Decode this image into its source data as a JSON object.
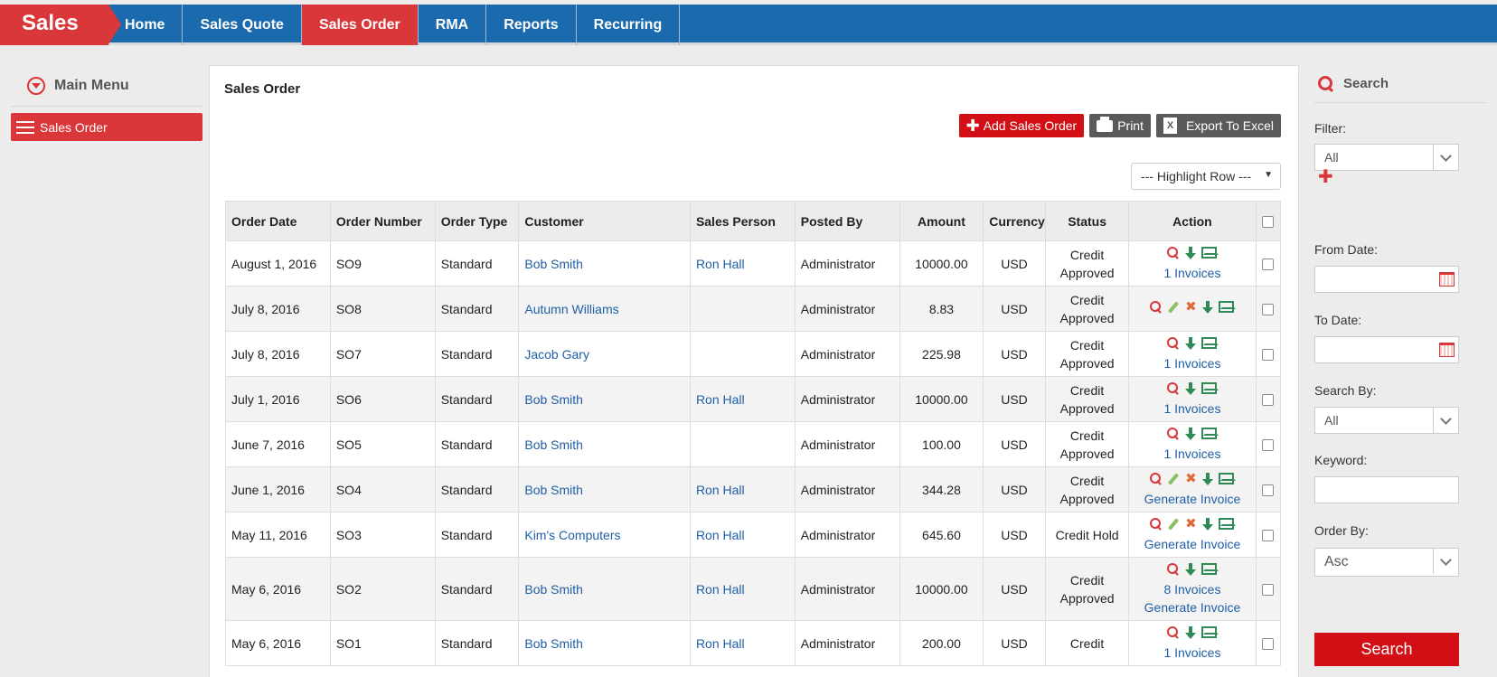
{
  "app": {
    "brand": "Sales"
  },
  "nav": {
    "home": "Home",
    "sales_quote": "Sales Quote",
    "sales_order": "Sales Order",
    "rma": "RMA",
    "reports": "Reports",
    "recurring": "Recurring"
  },
  "left_menu": {
    "title": "Main Menu",
    "item": "Sales Order"
  },
  "main": {
    "title": "Sales Order",
    "add_button": "Add Sales Order",
    "print_button": "Print",
    "export_button": "Export To Excel",
    "highlight_row": "--- Highlight Row ---"
  },
  "table": {
    "headers": {
      "order_date": "Order Date",
      "order_number": "Order Number",
      "order_type": "Order Type",
      "customer": "Customer",
      "sales_person": "Sales Person",
      "posted_by": "Posted By",
      "amount": "Amount",
      "currency": "Currency",
      "status": "Status",
      "action": "Action"
    },
    "rows": [
      {
        "date": "August 1, 2016",
        "number": "SO9",
        "type": "Standard",
        "customer": "Bob Smith",
        "sales_person": "Ron Hall",
        "posted_by": "Administrator",
        "amount": "10000.00",
        "currency": "USD",
        "status1": "Credit",
        "status2": "Approved",
        "link1": "1 Invoices",
        "link2": ""
      },
      {
        "date": "July 8, 2016",
        "number": "SO8",
        "type": "Standard",
        "customer": "Autumn Williams",
        "sales_person": "",
        "posted_by": "Administrator",
        "amount": "8.83",
        "currency": "USD",
        "status1": "Credit",
        "status2": "Approved",
        "link1": "",
        "link2": ""
      },
      {
        "date": "July 8, 2016",
        "number": "SO7",
        "type": "Standard",
        "customer": "Jacob Gary",
        "sales_person": "",
        "posted_by": "Administrator",
        "amount": "225.98",
        "currency": "USD",
        "status1": "Credit",
        "status2": "Approved",
        "link1": "1 Invoices",
        "link2": ""
      },
      {
        "date": "July 1, 2016",
        "number": "SO6",
        "type": "Standard",
        "customer": "Bob Smith",
        "sales_person": "Ron Hall",
        "posted_by": "Administrator",
        "amount": "10000.00",
        "currency": "USD",
        "status1": "Credit",
        "status2": "Approved",
        "link1": "1 Invoices",
        "link2": ""
      },
      {
        "date": "June 7, 2016",
        "number": "SO5",
        "type": "Standard",
        "customer": "Bob Smith",
        "sales_person": "",
        "posted_by": "Administrator",
        "amount": "100.00",
        "currency": "USD",
        "status1": "Credit",
        "status2": "Approved",
        "link1": "1 Invoices",
        "link2": ""
      },
      {
        "date": "June 1, 2016",
        "number": "SO4",
        "type": "Standard",
        "customer": "Bob Smith",
        "sales_person": "Ron Hall",
        "posted_by": "Administrator",
        "amount": "344.28",
        "currency": "USD",
        "status1": "Credit",
        "status2": "Approved",
        "link1": "Generate Invoice",
        "link2": ""
      },
      {
        "date": "May 11, 2016",
        "number": "SO3",
        "type": "Standard",
        "customer": "Kim's Computers",
        "sales_person": "Ron Hall",
        "posted_by": "Administrator",
        "amount": "645.60",
        "currency": "USD",
        "status1": "Credit Hold",
        "status2": "",
        "link1": "Generate Invoice",
        "link2": ""
      },
      {
        "date": "May 6, 2016",
        "number": "SO2",
        "type": "Standard",
        "customer": "Bob Smith",
        "sales_person": "Ron Hall",
        "posted_by": "Administrator",
        "amount": "10000.00",
        "currency": "USD",
        "status1": "Credit",
        "status2": "Approved",
        "link1": "8 Invoices",
        "link2": "Generate Invoice"
      },
      {
        "date": "May 6, 2016",
        "number": "SO1",
        "type": "Standard",
        "customer": "Bob Smith",
        "sales_person": "Ron Hall",
        "posted_by": "Administrator",
        "amount": "200.00",
        "currency": "USD",
        "status1": "Credit",
        "status2": "",
        "link1": "1 Invoices",
        "link2": ""
      }
    ]
  },
  "search": {
    "title": "Search",
    "filter_label": "Filter:",
    "filter_value": "All",
    "from_date_label": "From Date:",
    "to_date_label": "To Date:",
    "search_by_label": "Search By:",
    "search_by_value": "All",
    "keyword_label": "Keyword:",
    "order_by_label": "Order By:",
    "order_by_value": "Asc",
    "button": "Search"
  },
  "colors": {
    "brand_red": "#d9373a",
    "nav_blue": "#1b6aad",
    "status_green": "#6a9f3a",
    "link_blue": "#1f5fa6"
  }
}
